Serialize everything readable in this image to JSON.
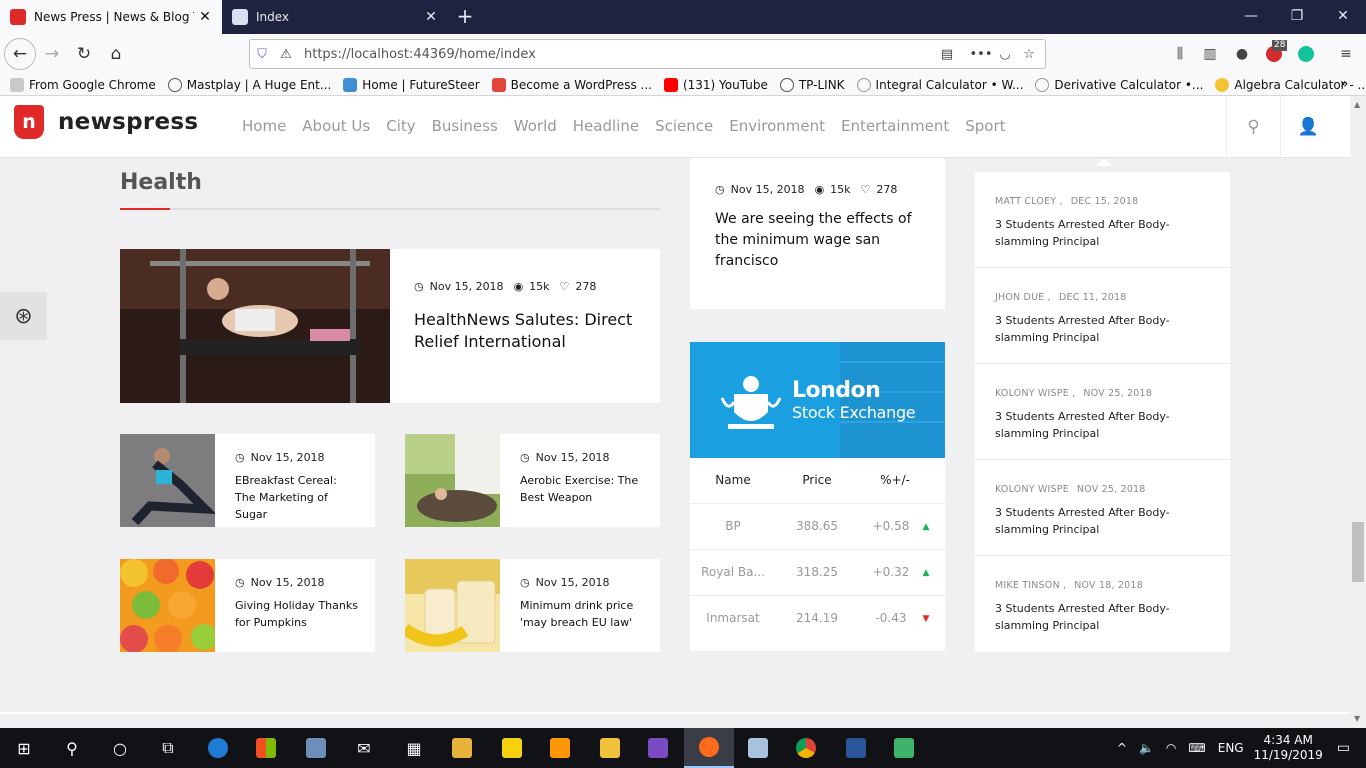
{
  "browser": {
    "tabs": [
      {
        "title": "News Press | News & Blog Temp",
        "active": true
      },
      {
        "title": "Index",
        "active": false
      }
    ],
    "url": "https://localhost:44369/home/index",
    "notification_count": "28",
    "bookmarks": [
      "From Google Chrome",
      "Mastplay | A Huge Ent...",
      "Home | FutureSteer",
      "Become a WordPress ...",
      "(131) YouTube",
      "TP-LINK",
      "Integral Calculator • W...",
      "Derivative Calculator •...",
      "Algebra Calculator - ..."
    ]
  },
  "site": {
    "brand": "newspress",
    "brand_mark": "n",
    "nav": [
      "Home",
      "About Us",
      "City",
      "Business",
      "World",
      "Headline",
      "Science",
      "Environment",
      "Entertainment",
      "Sport"
    ]
  },
  "health": {
    "heading": "Health",
    "featured": {
      "date": "Nov 15, 2018",
      "views": "15k",
      "likes": "278",
      "title": "HealthNews Salutes: Direct Relief International"
    },
    "small": [
      {
        "date": "Nov 15, 2018",
        "title": "EBreakfast Cereal: The Marketing of Sugar"
      },
      {
        "date": "Nov 15, 2018",
        "title": "Aerobic Exercise: The Best Weapon"
      },
      {
        "date": "Nov 15, 2018",
        "title": "Giving Holiday Thanks for Pumpkins"
      },
      {
        "date": "Nov 15, 2018",
        "title": "Minimum drink price 'may breach EU law'"
      }
    ]
  },
  "middle": {
    "post": {
      "date": "Nov 15, 2018",
      "views": "15k",
      "likes": "278",
      "title": "We are seeing the effects of the minimum wage san francisco"
    },
    "exchange": {
      "line1": "London",
      "line2": "Stock Exchange"
    },
    "stocks": {
      "headers": [
        "Name",
        "Price",
        "%+/-"
      ],
      "rows": [
        {
          "name": "BP",
          "price": "388.65",
          "change": "+0.58",
          "direction": "up"
        },
        {
          "name": "Royal Ba...",
          "price": "318.25",
          "change": "+0.32",
          "direction": "up"
        },
        {
          "name": "Inmarsat",
          "price": "214.19",
          "change": "-0.43",
          "direction": "down"
        }
      ],
      "up_color": "#1db34f",
      "down_color": "#e02a2a"
    }
  },
  "sidebar": {
    "posts": [
      {
        "author": "MATT CLOEY ,",
        "date": "DEC 15, 2018",
        "title": "3 Students Arrested After Body-slamming Principal"
      },
      {
        "author": "JHON DUE ,",
        "date": "DEC 11, 2018",
        "title": "3 Students Arrested After Body-slamming Principal"
      },
      {
        "author": "KOLONY WISPE ,",
        "date": "NOV 25, 2018",
        "title": "3 Students Arrested After Body-slamming Principal"
      },
      {
        "author": "KOLONY WISPE",
        "date": "NOV 25, 2018",
        "title": "3 Students Arrested After Body-slamming Principal"
      },
      {
        "author": "MIKE TINSON ,",
        "date": "NOV 18, 2018",
        "title": "3 Students Arrested After Body-slamming Principal"
      }
    ]
  },
  "taskbar": {
    "language": "ENG",
    "time": "4:34 AM",
    "date": "11/19/2019"
  },
  "colors": {
    "accent": "#e02a2a",
    "exchange_blue": "#1a9fe0"
  }
}
